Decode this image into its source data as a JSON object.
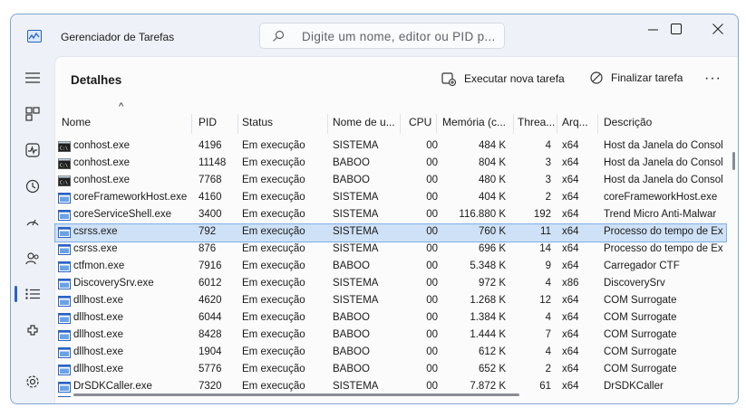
{
  "app": {
    "title": "Gerenciador de Tarefas"
  },
  "search": {
    "placeholder": "Digite um nome, editor ou PID p..."
  },
  "page": {
    "title": "Detalhes"
  },
  "toolbar": {
    "run_task": "Executar nova tarefa",
    "end_task": "Finalizar tarefa",
    "more": "···"
  },
  "sidebar": {
    "items": [
      {
        "name": "menu-icon",
        "active": false
      },
      {
        "name": "processes-icon",
        "active": false
      },
      {
        "name": "performance-icon",
        "active": false
      },
      {
        "name": "app-history-icon",
        "active": false
      },
      {
        "name": "startup-apps-icon",
        "active": false
      },
      {
        "name": "users-icon",
        "active": false
      },
      {
        "name": "details-icon",
        "active": true
      },
      {
        "name": "services-icon",
        "active": false
      },
      {
        "name": "settings-icon",
        "active": false
      }
    ]
  },
  "table": {
    "columns": [
      "Nome",
      "PID",
      "Status",
      "Nome de u...",
      "CPU",
      "Memória (c...",
      "Threa...",
      "Arq...",
      "Descrição"
    ],
    "sort_indicator": "^",
    "rows": [
      {
        "icon": "console",
        "name": "conhost.exe",
        "pid": "4196",
        "status": "Em execução",
        "user": "SISTEMA",
        "cpu": "00",
        "mem": "484 K",
        "threads": "4",
        "arch": "x64",
        "desc": "Host da Janela do Consol"
      },
      {
        "icon": "console",
        "name": "conhost.exe",
        "pid": "11148",
        "status": "Em execução",
        "user": "BABOO",
        "cpu": "00",
        "mem": "804 K",
        "threads": "3",
        "arch": "x64",
        "desc": "Host da Janela do Consol"
      },
      {
        "icon": "console",
        "name": "conhost.exe",
        "pid": "7768",
        "status": "Em execução",
        "user": "BABOO",
        "cpu": "00",
        "mem": "480 K",
        "threads": "3",
        "arch": "x64",
        "desc": "Host da Janela do Consol"
      },
      {
        "icon": "app",
        "name": "coreFrameworkHost.exe",
        "pid": "4160",
        "status": "Em execução",
        "user": "SISTEMA",
        "cpu": "00",
        "mem": "404 K",
        "threads": "2",
        "arch": "x64",
        "desc": "coreFrameworkHost.exe"
      },
      {
        "icon": "app",
        "name": "coreServiceShell.exe",
        "pid": "3400",
        "status": "Em execução",
        "user": "SISTEMA",
        "cpu": "00",
        "mem": "116.880 K",
        "threads": "192",
        "arch": "x64",
        "desc": "Trend Micro Anti-Malwar"
      },
      {
        "icon": "app",
        "name": "csrss.exe",
        "pid": "792",
        "status": "Em execução",
        "user": "SISTEMA",
        "cpu": "00",
        "mem": "760 K",
        "threads": "11",
        "arch": "x64",
        "desc": "Processo do tempo de Ex",
        "selected": true
      },
      {
        "icon": "app",
        "name": "csrss.exe",
        "pid": "876",
        "status": "Em execução",
        "user": "SISTEMA",
        "cpu": "00",
        "mem": "696 K",
        "threads": "14",
        "arch": "x64",
        "desc": "Processo do tempo de Ex"
      },
      {
        "icon": "app",
        "name": "ctfmon.exe",
        "pid": "7916",
        "status": "Em execução",
        "user": "BABOO",
        "cpu": "00",
        "mem": "5.348 K",
        "threads": "9",
        "arch": "x64",
        "desc": "Carregador CTF"
      },
      {
        "icon": "app",
        "name": "DiscoverySrv.exe",
        "pid": "6012",
        "status": "Em execução",
        "user": "SISTEMA",
        "cpu": "00",
        "mem": "972 K",
        "threads": "4",
        "arch": "x86",
        "desc": "DiscoverySrv"
      },
      {
        "icon": "app",
        "name": "dllhost.exe",
        "pid": "4620",
        "status": "Em execução",
        "user": "SISTEMA",
        "cpu": "00",
        "mem": "1.268 K",
        "threads": "12",
        "arch": "x64",
        "desc": "COM Surrogate"
      },
      {
        "icon": "app",
        "name": "dllhost.exe",
        "pid": "6044",
        "status": "Em execução",
        "user": "BABOO",
        "cpu": "00",
        "mem": "1.384 K",
        "threads": "4",
        "arch": "x64",
        "desc": "COM Surrogate"
      },
      {
        "icon": "app",
        "name": "dllhost.exe",
        "pid": "8428",
        "status": "Em execução",
        "user": "BABOO",
        "cpu": "00",
        "mem": "1.444 K",
        "threads": "7",
        "arch": "x64",
        "desc": "COM Surrogate"
      },
      {
        "icon": "app",
        "name": "dllhost.exe",
        "pid": "1904",
        "status": "Em execução",
        "user": "BABOO",
        "cpu": "00",
        "mem": "612 K",
        "threads": "4",
        "arch": "x64",
        "desc": "COM Surrogate"
      },
      {
        "icon": "app",
        "name": "dllhost.exe",
        "pid": "5776",
        "status": "Em execução",
        "user": "BABOO",
        "cpu": "00",
        "mem": "652 K",
        "threads": "2",
        "arch": "x64",
        "desc": "COM Surrogate"
      },
      {
        "icon": "app",
        "name": "DrSDKCaller.exe",
        "pid": "7320",
        "status": "Em execução",
        "user": "SISTEMA",
        "cpu": "00",
        "mem": "7.872 K",
        "threads": "61",
        "arch": "x64",
        "desc": "DrSDKCaller"
      }
    ]
  },
  "colors": {
    "accent": "#2a62c4",
    "selected_row": "#cfe1f6",
    "window_bg": "#eef1f7"
  }
}
